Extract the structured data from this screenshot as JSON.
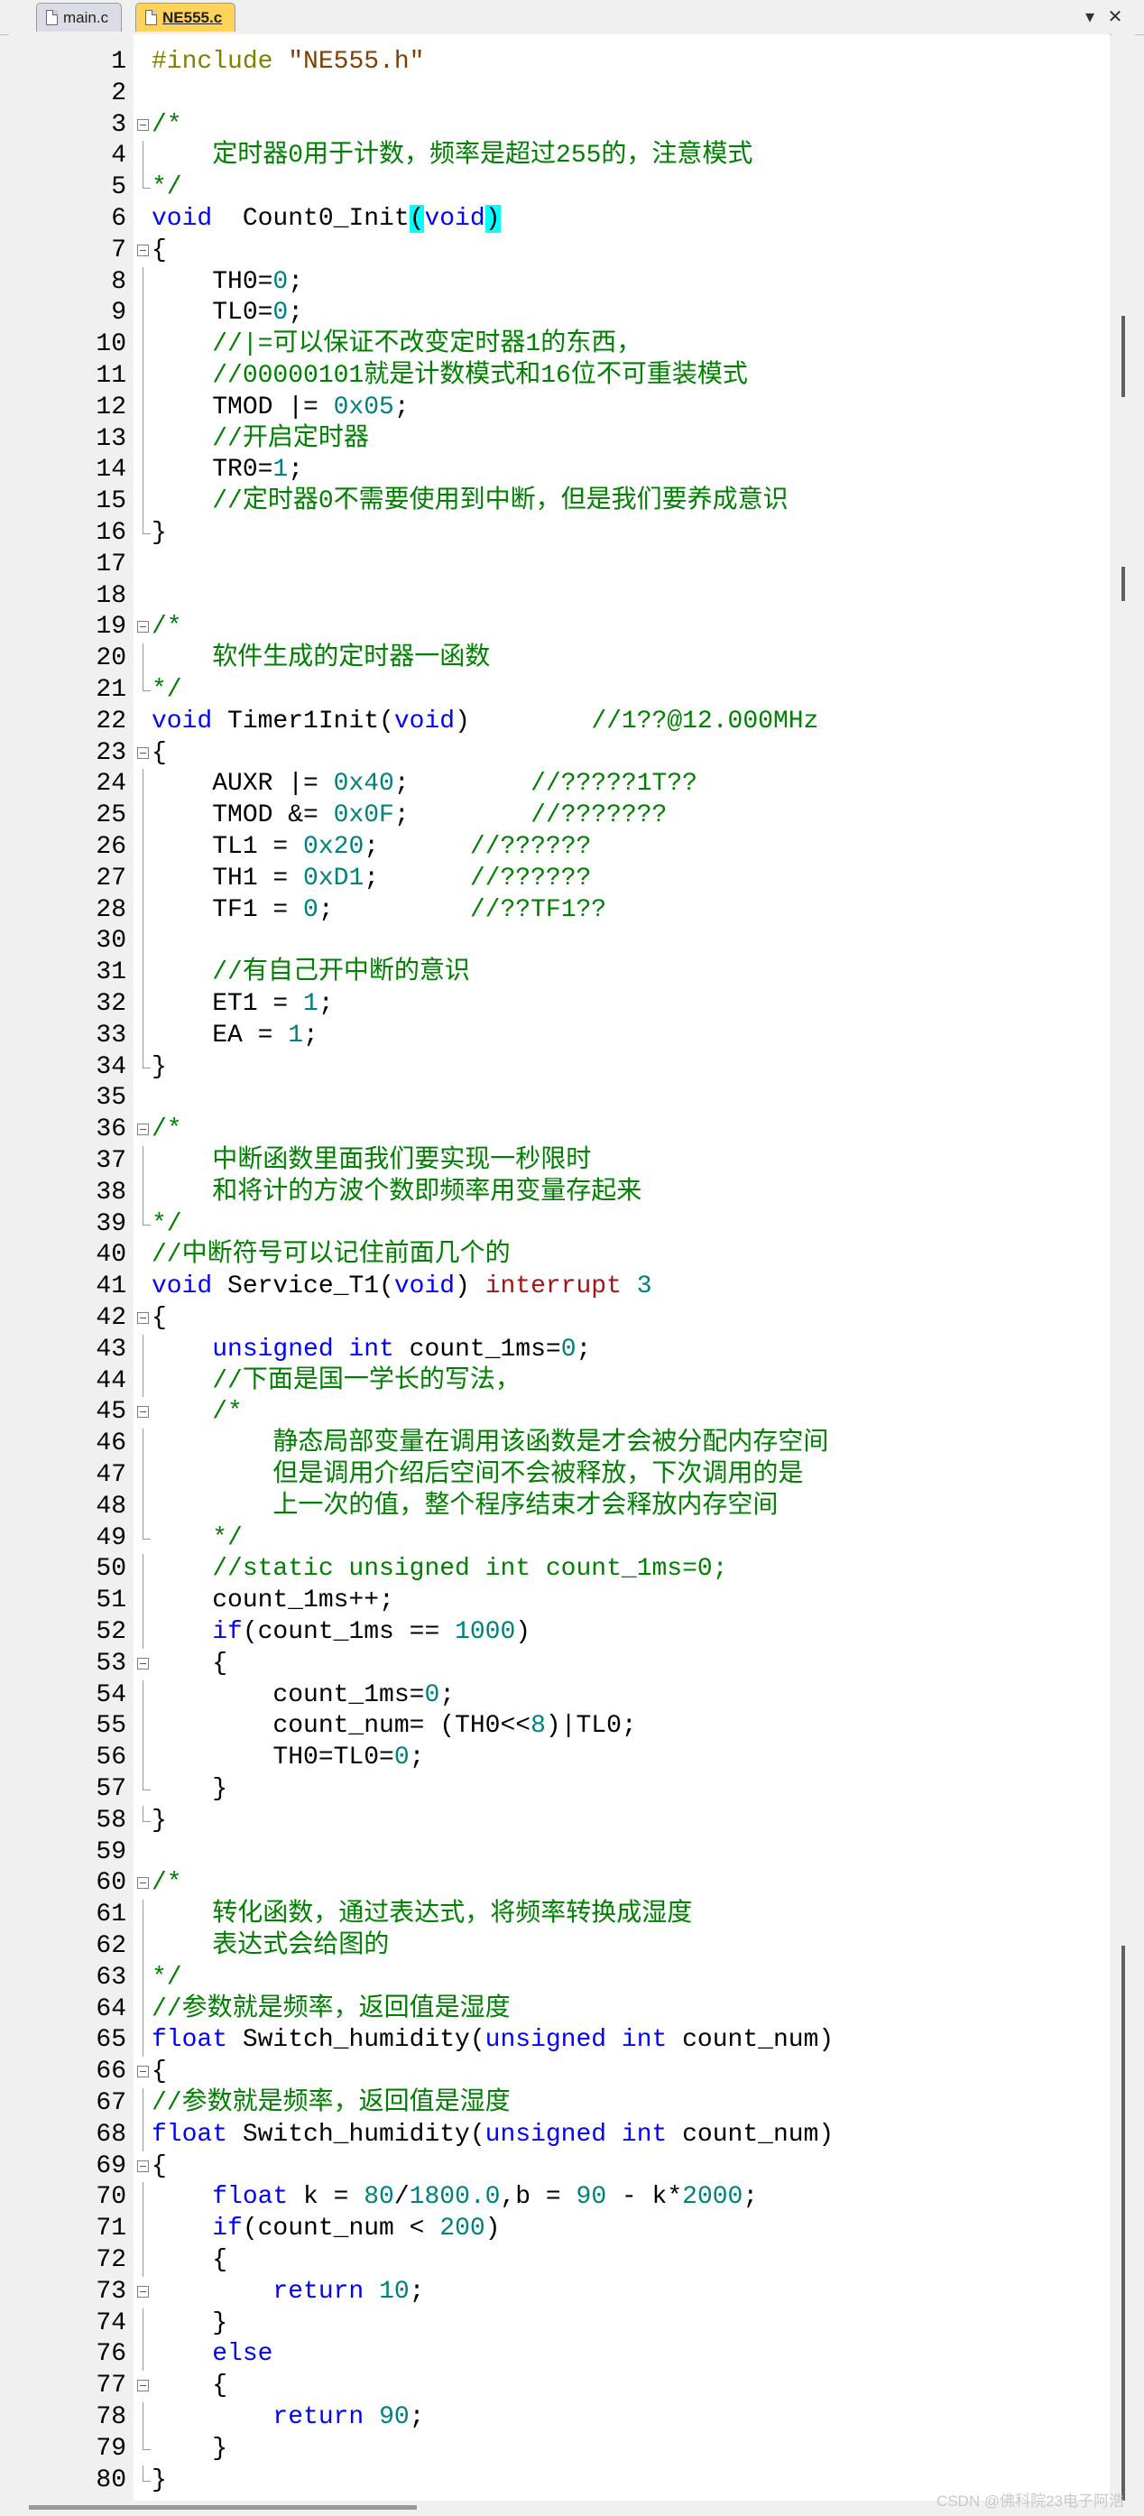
{
  "tabs": [
    {
      "name": "main.c",
      "active": false
    },
    {
      "name": "NE555.c",
      "active": true
    }
  ],
  "tab_controls": {
    "dropdown": "▾",
    "close": "✕"
  },
  "watermark": "CSDN @佛科院23电子阿浩",
  "colors": {
    "keyword": "#0000ff",
    "preprocessor": "#808000",
    "string": "#804000",
    "number": "#008080",
    "comment": "#008000",
    "interrupt": "#a31515",
    "highlight": "#00ffff",
    "active_tab": "#ffd35a"
  },
  "code_lines": [
    {
      "n": "1",
      "fold": "none",
      "segs": [
        [
          "pp",
          "#include "
        ],
        [
          "str",
          "\"NE555.h\""
        ]
      ]
    },
    {
      "n": "2",
      "fold": "none",
      "segs": []
    },
    {
      "n": "3",
      "fold": "start",
      "segs": [
        [
          "cm",
          "/*"
        ]
      ]
    },
    {
      "n": "4",
      "fold": "mid",
      "segs": [
        [
          "cm",
          "    定时器0用于计数，频率是超过255的，注意模式"
        ]
      ]
    },
    {
      "n": "5",
      "fold": "end",
      "segs": [
        [
          "cm",
          "*/"
        ]
      ]
    },
    {
      "n": "6",
      "fold": "none",
      "segs": [
        [
          "kw",
          "void"
        ],
        [
          "",
          "  Count0_Init"
        ],
        [
          "hl",
          "("
        ],
        [
          "kw",
          "void"
        ],
        [
          "hl",
          ")"
        ]
      ]
    },
    {
      "n": "7",
      "fold": "start",
      "segs": [
        [
          "",
          "{"
        ]
      ]
    },
    {
      "n": "8",
      "fold": "mid",
      "segs": [
        [
          "",
          "    TH0="
        ],
        [
          "num",
          "0"
        ],
        [
          "",
          ";"
        ]
      ]
    },
    {
      "n": "9",
      "fold": "mid",
      "segs": [
        [
          "",
          "    TL0="
        ],
        [
          "num",
          "0"
        ],
        [
          "",
          ";"
        ]
      ]
    },
    {
      "n": "10",
      "fold": "mid",
      "segs": [
        [
          "cm",
          "    //|=可以保证不改变定时器1的东西，"
        ]
      ]
    },
    {
      "n": "11",
      "fold": "mid",
      "segs": [
        [
          "cm",
          "    //00000101就是计数模式和16位不可重装模式"
        ]
      ]
    },
    {
      "n": "12",
      "fold": "mid",
      "segs": [
        [
          "",
          "    TMOD |= "
        ],
        [
          "num",
          "0x05"
        ],
        [
          "",
          ";"
        ]
      ]
    },
    {
      "n": "13",
      "fold": "mid",
      "segs": [
        [
          "cm",
          "    //开启定时器"
        ]
      ]
    },
    {
      "n": "14",
      "fold": "mid",
      "segs": [
        [
          "",
          "    TR0="
        ],
        [
          "num",
          "1"
        ],
        [
          "",
          ";"
        ]
      ]
    },
    {
      "n": "15",
      "fold": "mid",
      "segs": [
        [
          "cm",
          "    //定时器0不需要使用到中断，但是我们要养成意识"
        ]
      ]
    },
    {
      "n": "16",
      "fold": "end",
      "segs": [
        [
          "",
          "}"
        ]
      ]
    },
    {
      "n": "17",
      "fold": "none",
      "segs": []
    },
    {
      "n": "18",
      "fold": "none",
      "segs": []
    },
    {
      "n": "19",
      "fold": "start",
      "segs": [
        [
          "cm",
          "/*"
        ]
      ]
    },
    {
      "n": "20",
      "fold": "mid",
      "segs": [
        [
          "cm",
          "    软件生成的定时器一函数"
        ]
      ]
    },
    {
      "n": "21",
      "fold": "end",
      "segs": [
        [
          "cm",
          "*/"
        ]
      ]
    },
    {
      "n": "22",
      "fold": "none",
      "segs": [
        [
          "kw",
          "void"
        ],
        [
          "",
          " Timer1Init("
        ],
        [
          "kw",
          "void"
        ],
        [
          "",
          ")        "
        ],
        [
          "cm",
          "//1??@12.000MHz"
        ]
      ]
    },
    {
      "n": "23",
      "fold": "start",
      "segs": [
        [
          "",
          "{"
        ]
      ]
    },
    {
      "n": "24",
      "fold": "mid",
      "segs": [
        [
          "",
          "    AUXR |= "
        ],
        [
          "num",
          "0x40"
        ],
        [
          "",
          ";        "
        ],
        [
          "cm",
          "//?????1T??"
        ]
      ]
    },
    {
      "n": "25",
      "fold": "mid",
      "segs": [
        [
          "",
          "    TMOD &= "
        ],
        [
          "num",
          "0x0F"
        ],
        [
          "",
          ";        "
        ],
        [
          "cm",
          "//???????"
        ]
      ]
    },
    {
      "n": "26",
      "fold": "mid",
      "segs": [
        [
          "",
          "    TL1 = "
        ],
        [
          "num",
          "0x20"
        ],
        [
          "",
          ";      "
        ],
        [
          "cm",
          "//??????"
        ]
      ]
    },
    {
      "n": "27",
      "fold": "mid",
      "segs": [
        [
          "",
          "    TH1 = "
        ],
        [
          "num",
          "0xD1"
        ],
        [
          "",
          ";      "
        ],
        [
          "cm",
          "//??????"
        ]
      ]
    },
    {
      "n": "28",
      "fold": "mid",
      "segs": [
        [
          "",
          "    TF1 = "
        ],
        [
          "num",
          "0"
        ],
        [
          "",
          ";         "
        ],
        [
          "cm",
          "//??TF1??"
        ]
      ]
    },
    {
      "n": "30",
      "fold": "mid",
      "segs": []
    },
    {
      "n": "31",
      "fold": "mid",
      "segs": [
        [
          "cm",
          "    //有自己开中断的意识"
        ]
      ]
    },
    {
      "n": "32",
      "fold": "mid",
      "segs": [
        [
          "",
          "    ET1 = "
        ],
        [
          "num",
          "1"
        ],
        [
          "",
          ";"
        ]
      ]
    },
    {
      "n": "33",
      "fold": "mid",
      "segs": [
        [
          "",
          "    EA = "
        ],
        [
          "num",
          "1"
        ],
        [
          "",
          ";"
        ]
      ]
    },
    {
      "n": "34",
      "fold": "end",
      "segs": [
        [
          "",
          "}"
        ]
      ]
    },
    {
      "n": "35",
      "fold": "none",
      "segs": []
    },
    {
      "n": "36",
      "fold": "start",
      "segs": [
        [
          "cm",
          "/*"
        ]
      ]
    },
    {
      "n": "37",
      "fold": "mid",
      "segs": [
        [
          "cm",
          "    中断函数里面我们要实现一秒限时"
        ]
      ]
    },
    {
      "n": "38",
      "fold": "mid",
      "segs": [
        [
          "cm",
          "    和将计的方波个数即频率用变量存起来"
        ]
      ]
    },
    {
      "n": "39",
      "fold": "end",
      "segs": [
        [
          "cm",
          "*/"
        ]
      ]
    },
    {
      "n": "40",
      "fold": "none",
      "segs": [
        [
          "cm",
          "//中断符号可以记住前面几个的"
        ]
      ]
    },
    {
      "n": "41",
      "fold": "none",
      "segs": [
        [
          "kw",
          "void"
        ],
        [
          "",
          " Service_T1("
        ],
        [
          "kw",
          "void"
        ],
        [
          "",
          ") "
        ],
        [
          "int",
          "interrupt"
        ],
        [
          "",
          " "
        ],
        [
          "num",
          "3"
        ]
      ]
    },
    {
      "n": "42",
      "fold": "start",
      "segs": [
        [
          "",
          "{"
        ]
      ]
    },
    {
      "n": "43",
      "fold": "mid",
      "segs": [
        [
          "",
          "    "
        ],
        [
          "kw",
          "unsigned"
        ],
        [
          "",
          " "
        ],
        [
          "kw",
          "int"
        ],
        [
          "",
          " count_1ms="
        ],
        [
          "num",
          "0"
        ],
        [
          "",
          ";"
        ]
      ]
    },
    {
      "n": "44",
      "fold": "mid",
      "segs": [
        [
          "cm",
          "    //下面是国一学长的写法，"
        ]
      ]
    },
    {
      "n": "45",
      "fold": "start",
      "segs": [
        [
          "cm",
          "    /*"
        ]
      ]
    },
    {
      "n": "46",
      "fold": "mid",
      "segs": [
        [
          "cm",
          "        静态局部变量在调用该函数是才会被分配内存空间"
        ]
      ]
    },
    {
      "n": "47",
      "fold": "mid",
      "segs": [
        [
          "cm",
          "        但是调用介绍后空间不会被释放，下次调用的是"
        ]
      ]
    },
    {
      "n": "48",
      "fold": "mid",
      "segs": [
        [
          "cm",
          "        上一次的值，整个程序结束才会释放内存空间"
        ]
      ]
    },
    {
      "n": "49",
      "fold": "end",
      "segs": [
        [
          "cm",
          "    */"
        ]
      ]
    },
    {
      "n": "50",
      "fold": "mid",
      "segs": [
        [
          "cm",
          "    //static unsigned int count_1ms=0;"
        ]
      ]
    },
    {
      "n": "51",
      "fold": "mid",
      "segs": [
        [
          "",
          "    count_1ms++;"
        ]
      ]
    },
    {
      "n": "52",
      "fold": "mid",
      "segs": [
        [
          "",
          "    "
        ],
        [
          "kw",
          "if"
        ],
        [
          "",
          "(count_1ms == "
        ],
        [
          "num",
          "1000"
        ],
        [
          "",
          ")"
        ]
      ]
    },
    {
      "n": "53",
      "fold": "start",
      "segs": [
        [
          "",
          "    {"
        ]
      ]
    },
    {
      "n": "54",
      "fold": "mid",
      "segs": [
        [
          "",
          "        count_1ms="
        ],
        [
          "num",
          "0"
        ],
        [
          "",
          ";"
        ]
      ]
    },
    {
      "n": "55",
      "fold": "mid",
      "segs": [
        [
          "",
          "        count_num= (TH0<<"
        ],
        [
          "num",
          "8"
        ],
        [
          "",
          ")|TL0;"
        ]
      ]
    },
    {
      "n": "56",
      "fold": "mid",
      "segs": [
        [
          "",
          "        TH0=TL0="
        ],
        [
          "num",
          "0"
        ],
        [
          "",
          ";"
        ]
      ]
    },
    {
      "n": "57",
      "fold": "end",
      "segs": [
        [
          "",
          "    }"
        ]
      ]
    },
    {
      "n": "58",
      "fold": "end",
      "segs": [
        [
          "",
          "}"
        ]
      ]
    },
    {
      "n": "59",
      "fold": "none",
      "segs": []
    },
    {
      "n": "60",
      "fold": "start",
      "segs": [
        [
          "cm",
          "/*"
        ]
      ]
    },
    {
      "n": "61",
      "fold": "mid",
      "segs": [
        [
          "cm",
          "    转化函数，通过表达式，将频率转换成湿度"
        ]
      ]
    },
    {
      "n": "62",
      "fold": "mid",
      "segs": [
        [
          "cm",
          "    表达式会给图的"
        ]
      ]
    },
    {
      "n": "63",
      "fold": "mid",
      "segs": [
        [
          "cm",
          "*/"
        ]
      ]
    },
    {
      "n": "64",
      "fold": "mid",
      "segs": [
        [
          "cm",
          "//参数就是频率，返回值是湿度"
        ]
      ]
    },
    {
      "n": "65",
      "fold": "mid",
      "segs": [
        [
          "kw",
          "float"
        ],
        [
          "",
          " Switch_humidity("
        ],
        [
          "kw",
          "unsigned"
        ],
        [
          "",
          " "
        ],
        [
          "kw",
          "int"
        ],
        [
          "",
          " count_num)"
        ]
      ]
    },
    {
      "n": "66",
      "fold": "start",
      "segs": [
        [
          "",
          "{"
        ]
      ]
    },
    {
      "n": "67",
      "fold": "mid",
      "segs": [
        [
          "cm",
          "//参数就是频率，返回值是湿度"
        ]
      ]
    },
    {
      "n": "68",
      "fold": "mid",
      "segs": [
        [
          "kw",
          "float"
        ],
        [
          "",
          " Switch_humidity("
        ],
        [
          "kw",
          "unsigned"
        ],
        [
          "",
          " "
        ],
        [
          "kw",
          "int"
        ],
        [
          "",
          " count_num)"
        ]
      ]
    },
    {
      "n": "69",
      "fold": "start",
      "segs": [
        [
          "",
          "{"
        ]
      ]
    },
    {
      "n": "70",
      "fold": "mid",
      "segs": [
        [
          "",
          "    "
        ],
        [
          "kw",
          "float"
        ],
        [
          "",
          " k = "
        ],
        [
          "num",
          "80"
        ],
        [
          "",
          "/"
        ],
        [
          "num",
          "1800.0"
        ],
        [
          "",
          ",b = "
        ],
        [
          "num",
          "90"
        ],
        [
          "",
          " - k*"
        ],
        [
          "num",
          "2000"
        ],
        [
          "",
          ";"
        ]
      ]
    },
    {
      "n": "71",
      "fold": "mid",
      "segs": [
        [
          "",
          "    "
        ],
        [
          "kw",
          "if"
        ],
        [
          "",
          "(count_num < "
        ],
        [
          "num",
          "200"
        ],
        [
          "",
          ")"
        ]
      ]
    },
    {
      "n": "72",
      "fold": "mid",
      "segs": [
        [
          "",
          "    {"
        ]
      ]
    },
    {
      "n": "73",
      "fold": "start",
      "segs": [
        [
          "",
          "        "
        ],
        [
          "kw",
          "return"
        ],
        [
          "",
          " "
        ],
        [
          "num",
          "10"
        ],
        [
          "",
          ";"
        ]
      ]
    },
    {
      "n": "74",
      "fold": "mid",
      "segs": [
        [
          "",
          "    }"
        ]
      ]
    },
    {
      "n": "76",
      "fold": "mid",
      "segs": [
        [
          "",
          "    "
        ],
        [
          "kw",
          "else"
        ]
      ]
    },
    {
      "n": "77",
      "fold": "start",
      "segs": [
        [
          "",
          "    {"
        ]
      ]
    },
    {
      "n": "78",
      "fold": "mid",
      "segs": [
        [
          "",
          "        "
        ],
        [
          "kw",
          "return"
        ],
        [
          "",
          " "
        ],
        [
          "num",
          "90"
        ],
        [
          "",
          ";"
        ]
      ]
    },
    {
      "n": "79",
      "fold": "end",
      "segs": [
        [
          "",
          "    }"
        ]
      ]
    },
    {
      "n": "80",
      "fold": "end",
      "segs": [
        [
          "",
          "}"
        ]
      ]
    }
  ]
}
